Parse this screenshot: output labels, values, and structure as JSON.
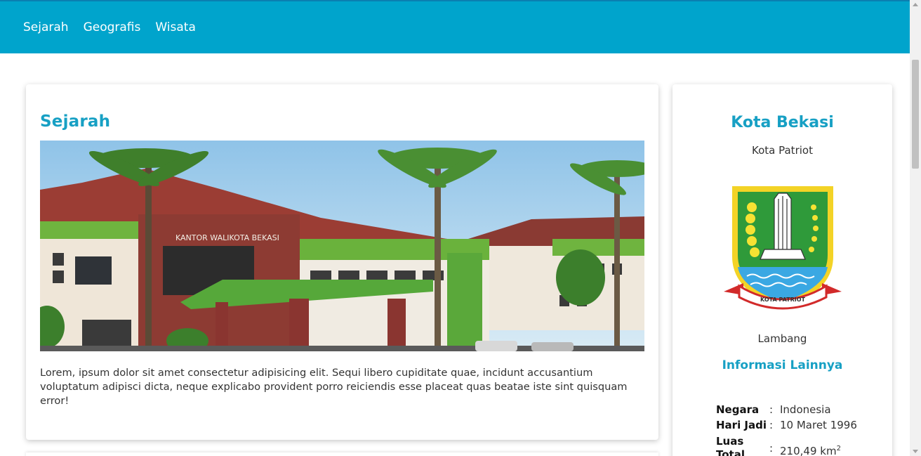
{
  "nav": {
    "links": [
      "Sejarah",
      "Geografis",
      "Wisata"
    ]
  },
  "main": {
    "title": "Sejarah",
    "image_sign": "KANTOR WALIKOTA BEKASI",
    "paragraph": "Lorem, ipsum dolor sit amet consectetur adipisicing elit. Sequi libero cupiditate quae, incidunt accusantium voluptatum adipisci dicta, neque explicabo provident porro reiciendis esse placeat quas beatae iste sint quisquam error!"
  },
  "sidebar": {
    "title": "Kota Bekasi",
    "subtitle": "Kota Patriot",
    "emblem_banner": "KOTA PATRIOT",
    "emblem_label": "Lambang",
    "info_title": "Informasi Lainnya",
    "info": [
      {
        "key": "Negara",
        "sep": ":",
        "value": "Indonesia"
      },
      {
        "key": "Hari Jadi",
        "sep": ":",
        "value": "10 Maret 1996"
      },
      {
        "key": "Luas Total",
        "sep": ":",
        "value": "210,49 km",
        "sup": "2"
      }
    ]
  },
  "colors": {
    "navbar": "#00a4cc",
    "accent": "#17a0c4"
  }
}
